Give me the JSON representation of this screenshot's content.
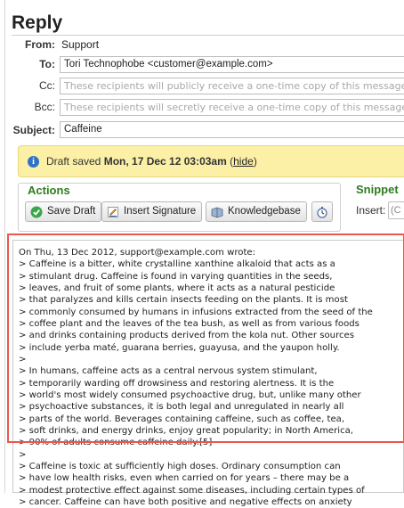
{
  "page": {
    "title": "Reply",
    "from_label": "From:",
    "from_value": "Support",
    "to_label": "To:",
    "to_value": "Tori Technophobe <customer@example.com>",
    "cc_label": "Cc:",
    "cc_placeholder": "These recipients will publicly receive a one-time copy of this message",
    "bcc_label": "Bcc:",
    "bcc_placeholder": "These recipients will secretly receive a one-time copy of this message",
    "subject_label": "Subject:",
    "subject_value": "Caffeine"
  },
  "draft": {
    "prefix": "Draft saved ",
    "date": "Mon, 17 Dec 12 03:03am",
    "open_paren": " (",
    "hide_link": "hide",
    "close_paren": ")"
  },
  "actions": {
    "title": "Actions",
    "save_draft": "Save Draft",
    "insert_signature": "Insert Signature",
    "knowledgebase": "Knowledgebase"
  },
  "snippets": {
    "title": "Snippet",
    "insert_label": "Insert:",
    "insert_value": "(C"
  },
  "message": {
    "lines": [
      "On Thu, 13 Dec 2012, support@example.com wrote:",
      "> Caffeine is a bitter, white crystalline xanthine alkaloid that acts as a",
      "> stimulant drug. Caffeine is found in varying quantities in the seeds,",
      "> leaves, and fruit of some plants, where it acts as a natural pesticide",
      "> that paralyzes and kills certain insects feeding on the plants. It is most",
      "> commonly consumed by humans in infusions extracted from the seed of the",
      "> coffee plant and the leaves of the tea bush, as well as from various foods",
      "> and drinks containing products derived from the kola nut. Other sources",
      "> include yerba maté, guarana berries, guayusa, and the yaupon holly.",
      ">",
      "> In humans, caffeine acts as a central nervous system stimulant,",
      "> temporarily warding off drowsiness and restoring alertness. It is the",
      "> world's most widely consumed psychoactive drug, but, unlike many other",
      "> psychoactive substances, it is both legal and unregulated in nearly all",
      "> parts of the world. Beverages containing caffeine, such as coffee, tea,",
      "> soft drinks, and energy drinks, enjoy great popularity; in North America,",
      "> 90% of adults consume caffeine daily.[5]",
      ">",
      "> Caffeine is toxic at sufficiently high doses. Ordinary consumption can",
      "> have low health risks, even when carried on for years – there may be a",
      "> modest protective effect against some diseases, including certain types of",
      "> cancer. Caffeine can have both positive and negative effects on anxiety"
    ]
  },
  "colors": {
    "highlight_border": "#e8584f",
    "section_title": "#2e7d1e",
    "draft_background": "#fbf0a6"
  }
}
